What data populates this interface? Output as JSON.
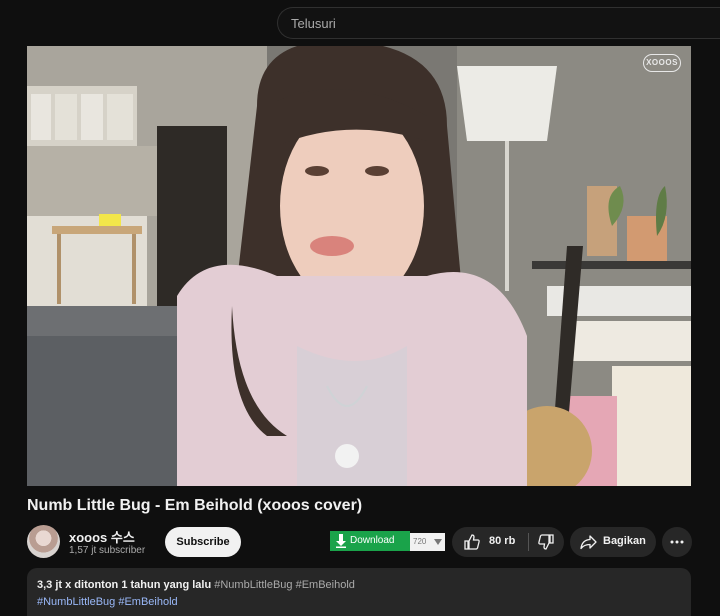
{
  "search": {
    "placeholder": "Telusuri"
  },
  "player": {
    "watermark": "XOOOS"
  },
  "video": {
    "title": "Numb Little Bug - Em Beihold (xooos cover)"
  },
  "channel": {
    "name": "xooos 수스",
    "subscribers": "1,57 jt subscriber",
    "subscribe_label": "Subscribe"
  },
  "download": {
    "label": "Download",
    "quality": "720"
  },
  "actions": {
    "like_count": "80 rb",
    "share_label": "Bagikan"
  },
  "description": {
    "stats": "3,3 jt x ditonton  1 tahun yang lalu",
    "tags_line1": [
      "#NumbLittleBug",
      "#EmBeihold"
    ],
    "tags_line2": [
      "#NumbLittleBug",
      "#EmBeihold"
    ]
  },
  "icons": {
    "download": "download-arrow-icon",
    "like": "thumbs-up-icon",
    "dislike": "thumbs-down-icon",
    "share": "share-arrow-icon",
    "more": "more-horizontal-icon"
  },
  "colors": {
    "background": "#0f0f0f",
    "download_green": "#1aa34a",
    "link_blue": "#9ab8f8",
    "chip": "#272727"
  }
}
